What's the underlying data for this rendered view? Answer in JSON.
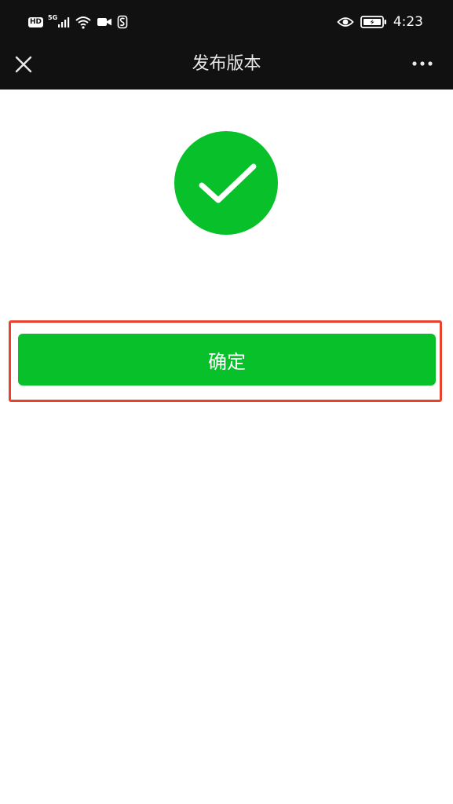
{
  "status_bar": {
    "hd_label": "HD",
    "network_label": "5G",
    "time": "4:23",
    "icons": [
      "hd-icon",
      "signal-icon",
      "wifi-icon",
      "video-camera-icon",
      "s-app-icon",
      "eye-icon",
      "battery-charging-icon"
    ]
  },
  "nav": {
    "title": "发布版本",
    "close_icon": "close-icon",
    "more_icon": "more-icon"
  },
  "main": {
    "status_icon": "check-circle-icon",
    "confirm_label": "确定"
  },
  "colors": {
    "header_bg": "#111111",
    "success_green": "#07c02a",
    "highlight_red": "#e8412c",
    "page_bg": "#ffffff"
  }
}
